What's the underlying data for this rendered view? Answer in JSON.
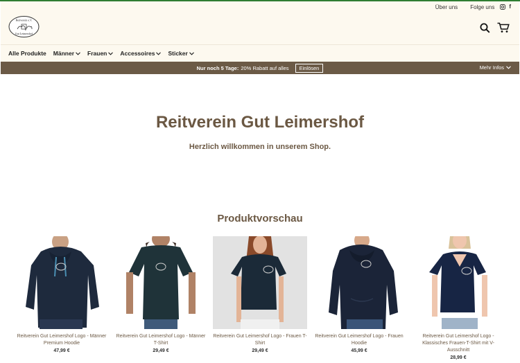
{
  "header": {
    "utility_links": [
      "Über uns",
      "Folge uns"
    ],
    "logo_text": [
      "Reitverein e.V.",
      "Gut Leimershof"
    ],
    "search_icon": "search-icon",
    "cart_icon": "cart-icon"
  },
  "nav": {
    "items": [
      {
        "label": "Alle Produkte"
      },
      {
        "label": "Männer"
      },
      {
        "label": "Frauen"
      },
      {
        "label": "Accessoires"
      },
      {
        "label": "Sticker"
      }
    ]
  },
  "promo": {
    "lead": "Nur noch 5 Tage:",
    "text": "20% Rabatt auf alles",
    "button": "Einlösen",
    "more": "Mehr Infos"
  },
  "hero": {
    "title": "Reitverein Gut Leimershof",
    "subtitle": "Herzlich willkommen in unserem Shop."
  },
  "preview": {
    "title": "Produktvorschau",
    "products": [
      {
        "name": "Reitverein Gut Leimershof Logo - Männer Premium Hoodie",
        "price": "47,99 €",
        "bg": "#ffffff",
        "color": "#1e2a3d"
      },
      {
        "name": "Reitverein Gut Leimershof Logo - Männer T-Shirt",
        "price": "29,49 €",
        "bg": "#ffffff",
        "color": "#1f3339"
      },
      {
        "name": "Reitverein Gut Leimershof Logo - Frauen T-Shirt",
        "price": "29,49 €",
        "bg": "#e2e2e2",
        "color": "#1b2a38"
      },
      {
        "name": "Reitverein Gut Leimershof Logo - Frauen Hoodie",
        "price": "45,99 €",
        "bg": "#ffffff",
        "color": "#1b2438"
      },
      {
        "name": "Reitverein Gut Leimershof Logo - Klassisches Frauen-T-Shirt mit V-Ausschnitt",
        "price": "28,99 €",
        "bg": "#ffffff",
        "color": "#172544"
      }
    ]
  }
}
